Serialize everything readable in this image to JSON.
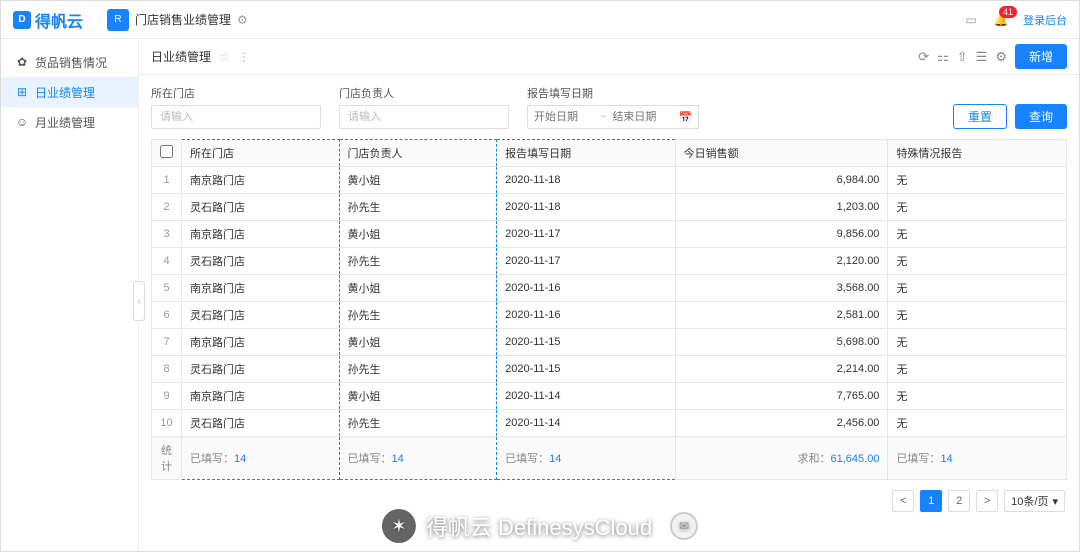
{
  "header": {
    "brand": "得帆云",
    "app_title": "门店销售业绩管理",
    "bell_count": "41",
    "login": "登录后台"
  },
  "sidebar": {
    "items": [
      {
        "icon": "✿",
        "label": "货品销售情况"
      },
      {
        "icon": "⊞",
        "label": "日业绩管理"
      },
      {
        "icon": "☺",
        "label": "月业绩管理"
      }
    ]
  },
  "toolbar": {
    "title": "日业绩管理",
    "add_label": "新增"
  },
  "filters": {
    "store_label": "所在门店",
    "store_placeholder": "请输入",
    "owner_label": "门店负责人",
    "owner_placeholder": "请输入",
    "date_label": "报告填写日期",
    "date_start_placeholder": "开始日期",
    "date_end_placeholder": "结束日期",
    "reset_label": "重置",
    "search_label": "查询"
  },
  "table": {
    "columns": {
      "store": "所在门店",
      "owner": "门店负责人",
      "date": "报告填写日期",
      "sales": "今日销售额",
      "report": "特殊情况报告"
    },
    "rows": [
      {
        "n": 1,
        "store": "南京路门店",
        "owner": "黄小姐",
        "date": "2020-11-18",
        "sales": "6,984.00",
        "report": "无"
      },
      {
        "n": 2,
        "store": "灵石路门店",
        "owner": "孙先生",
        "date": "2020-11-18",
        "sales": "1,203.00",
        "report": "无"
      },
      {
        "n": 3,
        "store": "南京路门店",
        "owner": "黄小姐",
        "date": "2020-11-17",
        "sales": "9,856.00",
        "report": "无"
      },
      {
        "n": 4,
        "store": "灵石路门店",
        "owner": "孙先生",
        "date": "2020-11-17",
        "sales": "2,120.00",
        "report": "无"
      },
      {
        "n": 5,
        "store": "南京路门店",
        "owner": "黄小姐",
        "date": "2020-11-16",
        "sales": "3,568.00",
        "report": "无"
      },
      {
        "n": 6,
        "store": "灵石路门店",
        "owner": "孙先生",
        "date": "2020-11-16",
        "sales": "2,581.00",
        "report": "无"
      },
      {
        "n": 7,
        "store": "南京路门店",
        "owner": "黄小姐",
        "date": "2020-11-15",
        "sales": "5,698.00",
        "report": "无"
      },
      {
        "n": 8,
        "store": "灵石路门店",
        "owner": "孙先生",
        "date": "2020-11-15",
        "sales": "2,214.00",
        "report": "无"
      },
      {
        "n": 9,
        "store": "南京路门店",
        "owner": "黄小姐",
        "date": "2020-11-14",
        "sales": "7,765.00",
        "report": "无"
      },
      {
        "n": 10,
        "store": "灵石路门店",
        "owner": "孙先生",
        "date": "2020-11-14",
        "sales": "2,456.00",
        "report": "无"
      }
    ],
    "summary": {
      "label": "统计",
      "filled_prefix": "已填写：",
      "filled_count": "14",
      "sum_prefix": "求和：",
      "sum_value": "61,645.00"
    }
  },
  "pager": {
    "pages": [
      "1",
      "2"
    ],
    "active": 0,
    "size": "10条/页"
  },
  "overlay": {
    "wechat": "✶",
    "text": "得帆云 DefinesysCloud",
    "msg": "✉"
  }
}
